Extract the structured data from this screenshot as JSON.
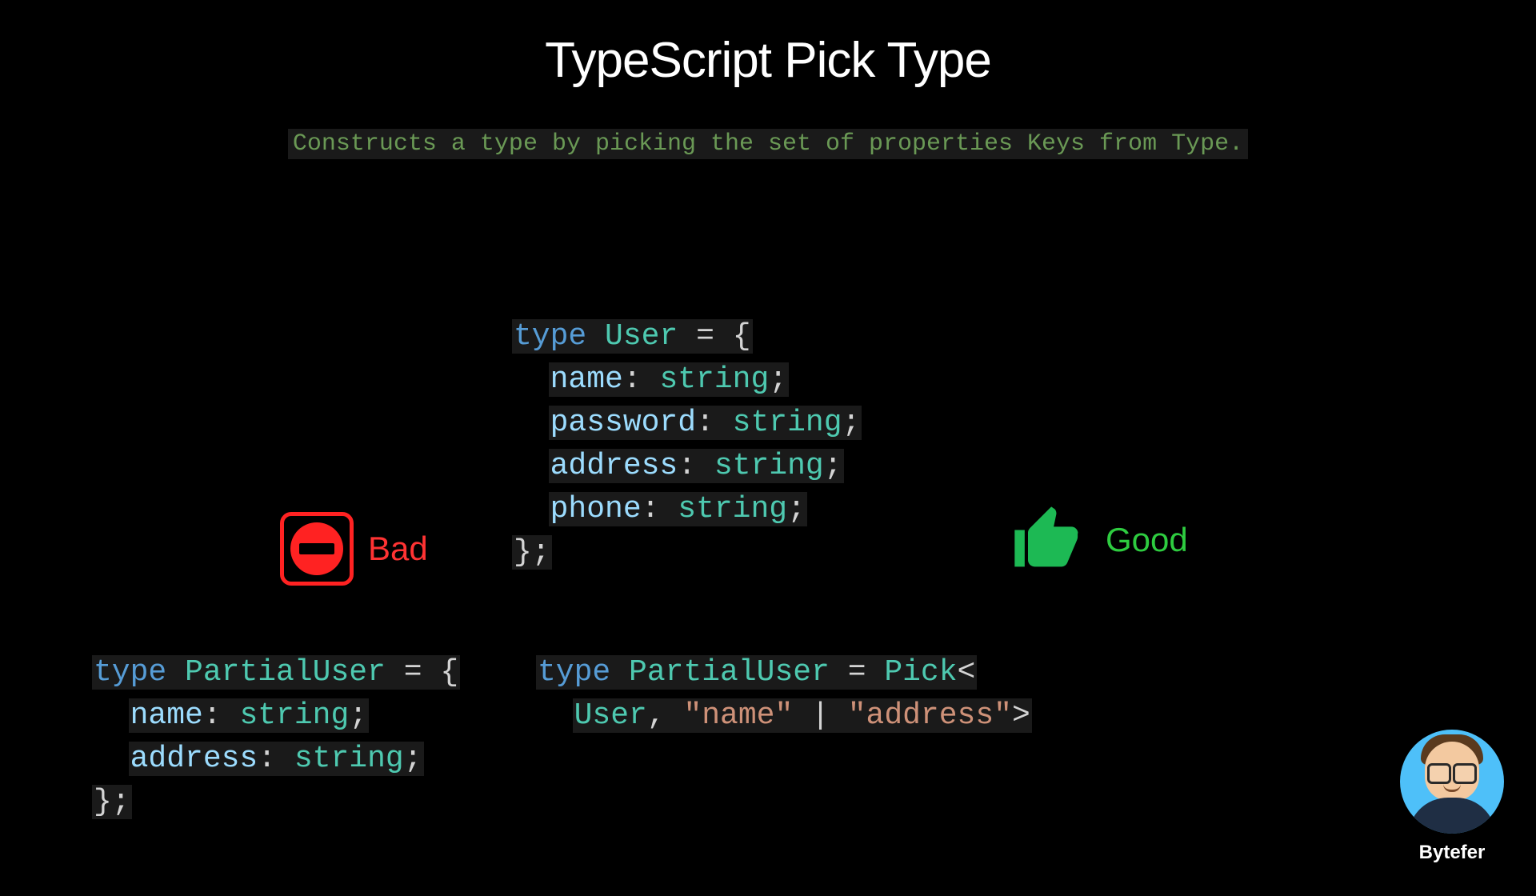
{
  "title": "TypeScript Pick Type",
  "subtitle": "Constructs a type by picking the set of properties Keys from Type.",
  "bad_label": "Bad",
  "good_label": "Good",
  "author": "Bytefer",
  "code_main": {
    "l1": {
      "kw": "type",
      "name": "User",
      "op": "=",
      "open": "{"
    },
    "l2": {
      "prop": "name",
      "colon": ":",
      "type": "string",
      "semi": ";"
    },
    "l3": {
      "prop": "password",
      "colon": ":",
      "type": "string",
      "semi": ";"
    },
    "l4": {
      "prop": "address",
      "colon": ":",
      "type": "string",
      "semi": ";"
    },
    "l5": {
      "prop": "phone",
      "colon": ":",
      "type": "string",
      "semi": ";"
    },
    "l6": {
      "close": "};"
    }
  },
  "code_bad": {
    "l1": {
      "kw": "type",
      "name": "PartialUser",
      "op": "=",
      "open": "{"
    },
    "l2": {
      "prop": "name",
      "colon": ":",
      "type": "string",
      "semi": ";"
    },
    "l3": {
      "prop": "address",
      "colon": ":",
      "type": "string",
      "semi": ";"
    },
    "l4": {
      "close": "};"
    }
  },
  "code_good": {
    "l1": {
      "kw": "type",
      "name": "PartialUser",
      "op": "=",
      "pick": "Pick",
      "lt": "<"
    },
    "l2": {
      "user": "User",
      "comma": ",",
      "s1": "\"name\"",
      "pipe": "|",
      "s2": "\"address\"",
      "gt": ">"
    }
  }
}
